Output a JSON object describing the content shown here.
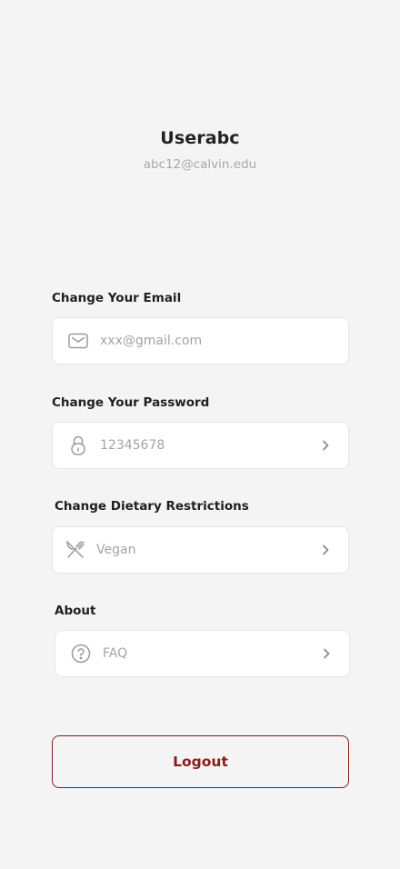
{
  "profile": {
    "username": "Userabc",
    "email": "abc12@calvin.edu"
  },
  "email_section": {
    "label": "Change Your Email",
    "placeholder": "xxx@gmail.com",
    "icon": "mail-icon"
  },
  "password_section": {
    "label": "Change Your Password",
    "value": "12345678",
    "icon": "lock-icon"
  },
  "dietary_section": {
    "label": "Change Dietary Restrictions",
    "value": "Vegan",
    "icon": "utensils-icon"
  },
  "about_section": {
    "label": "About",
    "value": "FAQ",
    "icon": "question-circle-icon"
  },
  "logout": {
    "label": "Logout"
  },
  "colors": {
    "background": "#f4f4f4",
    "accent": "#8b1a1a",
    "muted_text": "#a3a3a3"
  }
}
